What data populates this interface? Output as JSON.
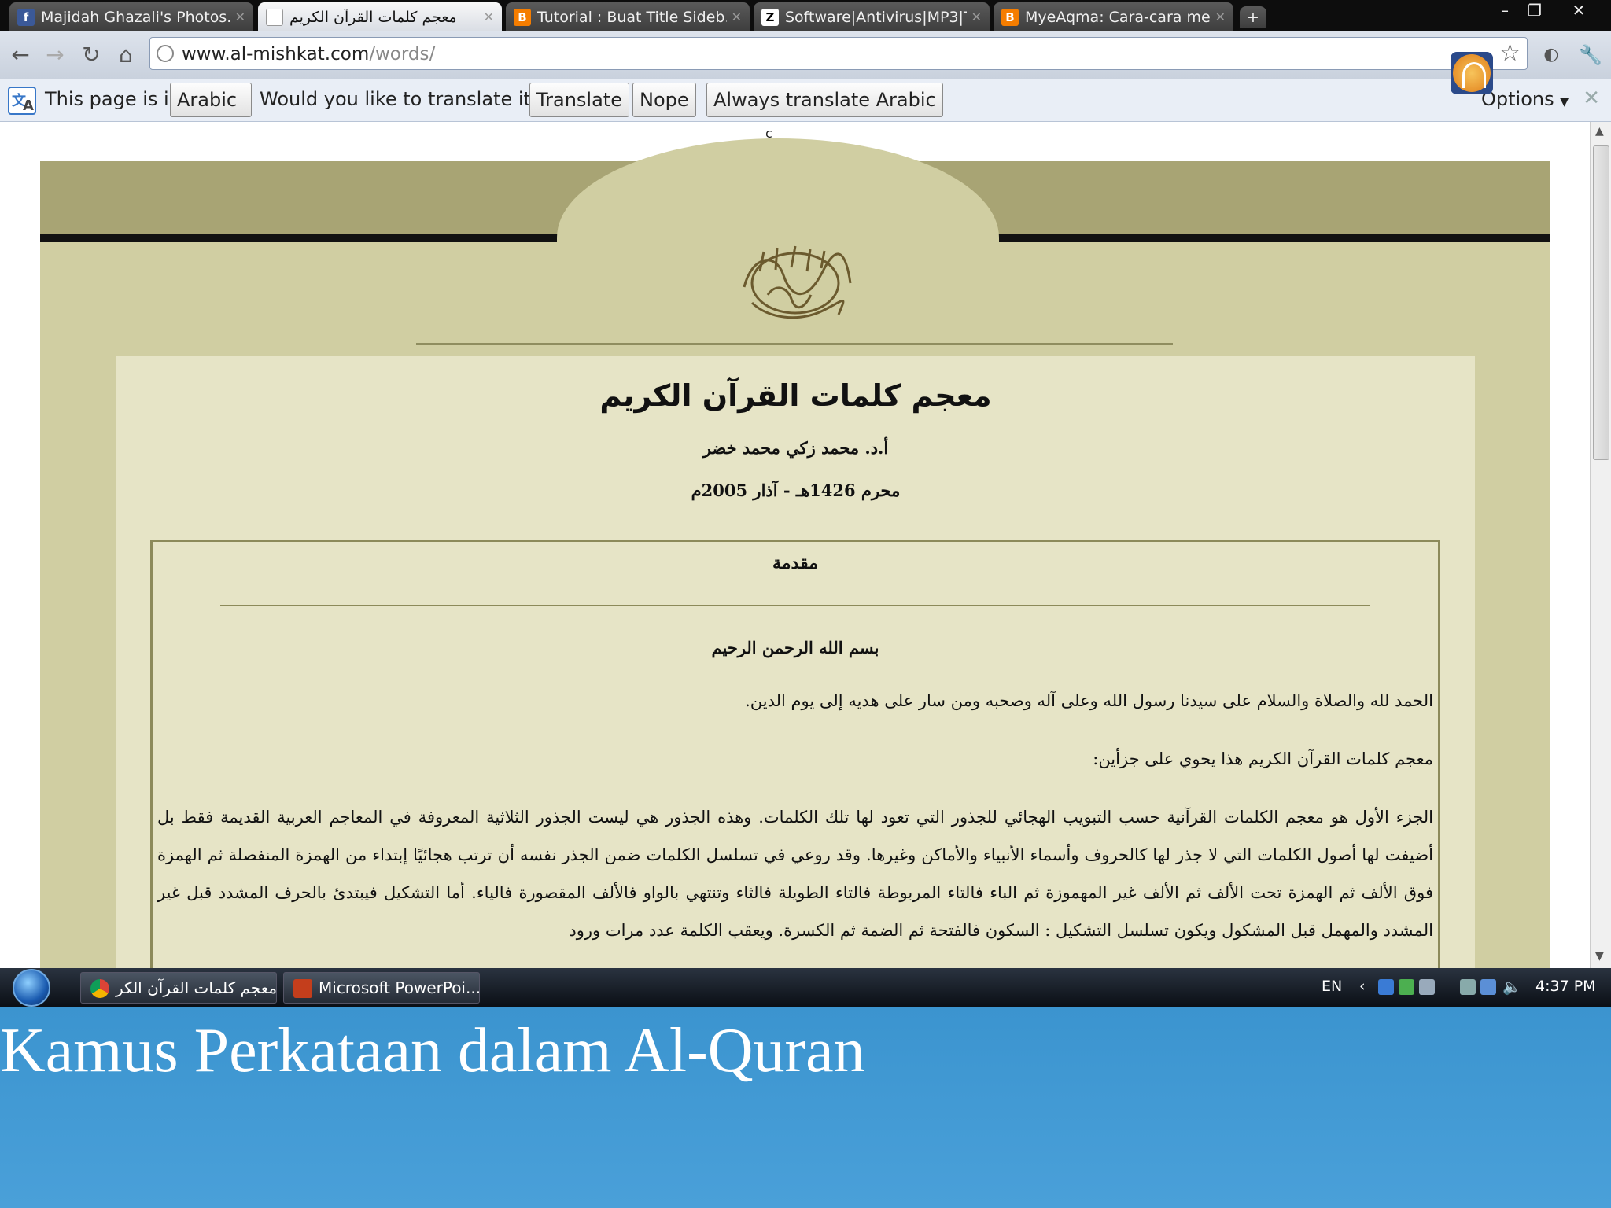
{
  "browser": {
    "tabs": [
      {
        "title": "Majidah Ghazali's Photos...",
        "icon": "facebook-icon"
      },
      {
        "title": "معجم كلمات القرآن الكريم",
        "icon": "page-icon"
      },
      {
        "title": "Tutorial : Buat Title Sideb...",
        "icon": "blogger-icon"
      },
      {
        "title": "Software|Antivirus|MP3|T...",
        "icon": "z-site-icon"
      },
      {
        "title": "MyeAqma: Cara-cara me...",
        "icon": "blogger-icon"
      }
    ],
    "new_tab_label": "+",
    "window_controls": {
      "minimize": "–",
      "restore": "❐",
      "close": "✕"
    },
    "url_domain": "www.al-mishkat.com",
    "url_path": "/words/"
  },
  "translate_bar": {
    "prefix": "This page is in",
    "language": "Arabic",
    "question": "Would you like to translate it?",
    "translate": "Translate",
    "nope": "Nope",
    "always": "Always translate Arabic",
    "options": "Options"
  },
  "page": {
    "stray_char": "c",
    "title": "معجم كلمات القرآن الكريم",
    "author": "أ.د. محمد زكي محمد خضر",
    "date": "محرم 1426هـ - آذار 2005م",
    "intro_heading": "مقدمة",
    "basmala": "بسم الله الرحمن الرحيم",
    "para1": "الحمد لله والصلاة والسلام على سيدنا رسول الله وعلى آله وصحبه ومن سار على هديه إلى يوم الدين.",
    "para2": "معجم كلمات القرآن الكريم هذا يحوي على جزأين:",
    "para3": "الجزء الأول هو معجم الكلمات القرآنية حسب التبويب الهجائي للجذور التي تعود لها تلك الكلمات. وهذه الجذور هي ليست الجذور الثلاثية المعروفة في المعاجم العربية القديمة فقط بل أضيفت لها أصول الكلمات التي لا جذر لها كالحروف وأسماء الأنبياء والأماكن وغيرها. وقد روعي في تسلسل الكلمات ضمن الجذر نفسه أن ترتب هجائيًا إبتداء من الهمزة المنفصلة ثم الهمزة فوق الألف ثم الهمزة تحت الألف ثم الألف غير المهموزة ثم الباء فالتاء المربوطة فالتاء الطويلة فالثاء وتنتهي بالواو فالألف المقصورة فالياء. أما التشكيل فيبتدئ بالحرف المشدد قبل غير المشدد والمهمل قبل المشكول ويكون تسلسل التشكيل : السكون فالفتحة ثم الضمة ثم الكسرة. ويعقب الكلمة عدد مرات ورود"
  },
  "taskbar": {
    "items": [
      {
        "label": "معجم كلمات القرآن الكر...",
        "icon": "chrome-icon"
      },
      {
        "label": "Microsoft PowerPoi...",
        "icon": "powerpoint-icon"
      }
    ],
    "language": "EN",
    "time": "4:37 PM"
  },
  "caption": "Kamus Perkataan dalam Al-Quran",
  "colors": {
    "page_band": "#a8a474",
    "page_bg": "#d0cea2",
    "content_bg": "#e6e4c6",
    "caption_bg": "#3b94cf"
  }
}
